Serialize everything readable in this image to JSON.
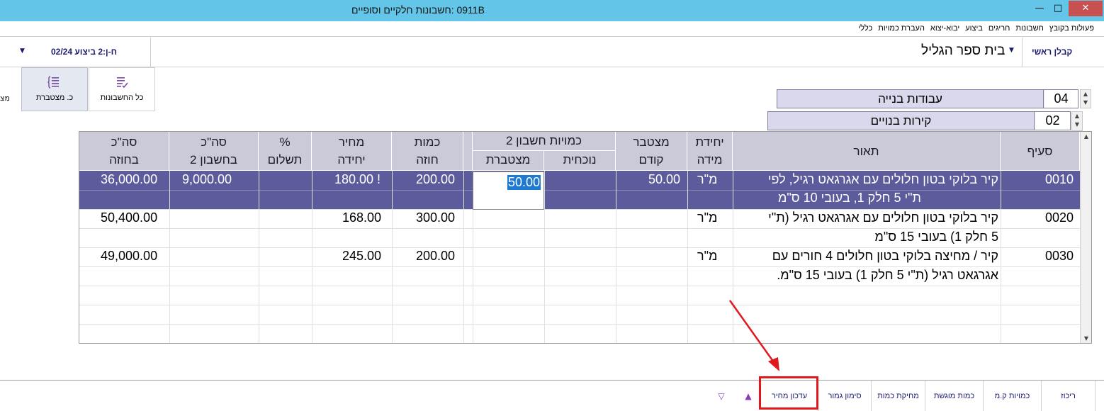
{
  "window": {
    "title": "0911B :חשבונות חלקיים וסופיים",
    "min_glyph": "—",
    "max_glyph": "□",
    "close_glyph": "✕"
  },
  "menu": [
    "פעולות בקובץ",
    "חשבונות",
    "חריגים",
    "ביצוע",
    "יבוא-יצוא",
    "העברת כמויות",
    "כללי"
  ],
  "header": {
    "contractor": "קבלן ראשי",
    "project": "בית ספר הגליל",
    "account": "ח-ן:2 ביצוע 02/24",
    "dropdown_glyph": "▼"
  },
  "ribbon": {
    "all_accounts": "כל החשבונות",
    "cumulative": "כ. מצטברת",
    "cut_text": "מצ"
  },
  "categories": [
    {
      "code": "04",
      "name": "עבודות בנייה"
    },
    {
      "code": "02",
      "name": "קירות בנויים"
    }
  ],
  "scroll": {
    "up": "▲",
    "down": "▼"
  },
  "table": {
    "headers": {
      "section": "סעיף",
      "description": "תאור",
      "unit_1": "יחידת",
      "unit_2": "מידה",
      "prev_1": "מצטבר",
      "prev_2": "קודם",
      "group": "כמויות חשבון 2",
      "current": "נוכחית",
      "cumulative": "מצטברת",
      "qty_1": "כמות",
      "qty_2": "חוזה",
      "price_1": "מחיר",
      "price_2": "יחידה",
      "pay_1": "%",
      "pay_2": "תשלום",
      "total_acc_1": "סה\"כ",
      "total_acc_2": "בחשבון 2",
      "total_contract_1": "סה\"כ",
      "total_contract_2": "בחוזה"
    },
    "rows": [
      {
        "section": "0010",
        "desc_1": "קיר בלוקי בטון חלולים עם אגרגאט רגיל, לפי",
        "desc_2": "ת\"י 5 חלק 1, בעובי 10 ס\"מ",
        "unit": "מ\"ר",
        "prev": "50.00",
        "current": "",
        "cumulative": "50.00",
        "qty": "200.00",
        "price": "180.00 !",
        "pay": "",
        "total_account": "9,000.00",
        "total_contract": "36,000.00"
      },
      {
        "section": "0020",
        "desc_1": "קיר בלוקי בטון חלולים עם אגרגאט רגיל (ת\"י",
        "desc_2": "5 חלק 1) בעובי 15 ס\"מ",
        "unit": "מ\"ר",
        "prev": "",
        "current": "",
        "cumulative": "",
        "qty": "300.00",
        "price": "168.00",
        "pay": "",
        "total_account": "",
        "total_contract": "50,400.00"
      },
      {
        "section": "0030",
        "desc_1": "קיר / מחיצה בלוקי בטון חלולים 4 חורים עם",
        "desc_2": "אגרגאט רגיל (ת\"י 5 חלק 1) בעובי 15 ס\"מ.",
        "unit": "מ\"ר",
        "prev": "",
        "current": "",
        "cumulative": "",
        "qty": "200.00",
        "price": "245.00",
        "pay": "",
        "total_account": "",
        "total_contract": "49,000.00"
      }
    ]
  },
  "bottom": {
    "buttons": [
      "ריכוז",
      "כמויות ק.מ",
      "כמות מוגשת",
      "מחיקת כמות",
      "סימון גמור",
      "עדכון מחיר"
    ],
    "up_glyph": "▲",
    "down_glyph": "▽"
  },
  "colors": {
    "titlebar": "#63c6e8",
    "header_bg": "#cacad8",
    "selected_row": "#5c5c9c",
    "edit_highlight": "#1c7ad4",
    "annotation_red": "#e0191c"
  }
}
